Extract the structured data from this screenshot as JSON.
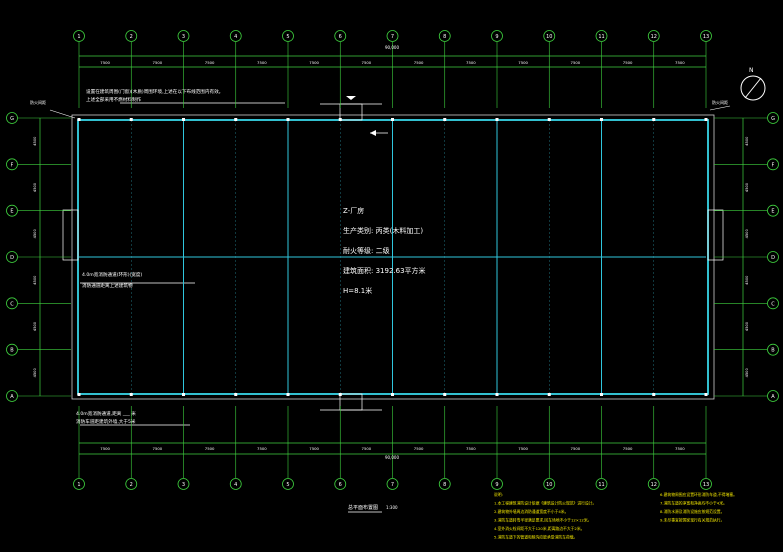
{
  "grid": {
    "columns": [
      "1",
      "2",
      "3",
      "4",
      "5",
      "6",
      "7",
      "8",
      "9",
      "10",
      "11",
      "12",
      "13"
    ],
    "rows": [
      "G",
      "F",
      "E",
      "D",
      "C",
      "B",
      "A"
    ]
  },
  "building": {
    "name": "Z-厂房",
    "use": "生产类别: 丙类(木料加工)",
    "fire_grade": "耐火等级: 二级",
    "area": "建筑面积: 3192.63平方米",
    "height": "H=8.1米"
  },
  "top_dimensions": [
    "7500",
    "7500",
    "7500",
    "7500",
    "7500",
    "7500",
    "7500",
    "7500",
    "7500",
    "7500",
    "7500",
    "7500"
  ],
  "top_total": "90,000",
  "side_dimensions": [
    "4500",
    "4500",
    "4500",
    "4500",
    "4500",
    "4500"
  ],
  "notes": {
    "top_left_line1": "设置在建筑周围(门窗)(木质)周围环境,上述在以下布线范围内有效。",
    "top_left_line2": "上述全部采用不燃材料制作",
    "mid_left_line1": "4.0m宽消防通道(环形)(宽度)",
    "mid_left_line2": "消防通道距离上述建筑物",
    "bottom_left_line1": "4.0m宽消防通道,距离 ___ 米",
    "bottom_left_line2": "消防车道距建筑外墙,大于5米",
    "top_left_tag": "防火间距",
    "right_tag": "防火间距"
  },
  "plan_title": "总平面布置图",
  "plan_scale": "1:300",
  "general_notes": [
    "说明:",
    "1.本工程建筑消防设计依据《建筑设计防火规范》进行设计。",
    "2.建筑物外墙周边消防通道宽度不小于4米。",
    "3.消防车道转弯半径满足要求,回车场地不小于12×12米。",
    "4.室外消火栓间距不大于120米,距离路边不大于2米。",
    "5.消防车道下的管道和暗沟应能承受消防车荷载。"
  ],
  "general_notes_right": [
    "6.建筑物周围应设置环形消防车道,不得堵塞。",
    "7.消防车道的净宽和净高均不小于4米。",
    "8.消防水源及消防设施应按规范设置。",
    "9.未尽事宜按国家现行有关规范执行。"
  ]
}
